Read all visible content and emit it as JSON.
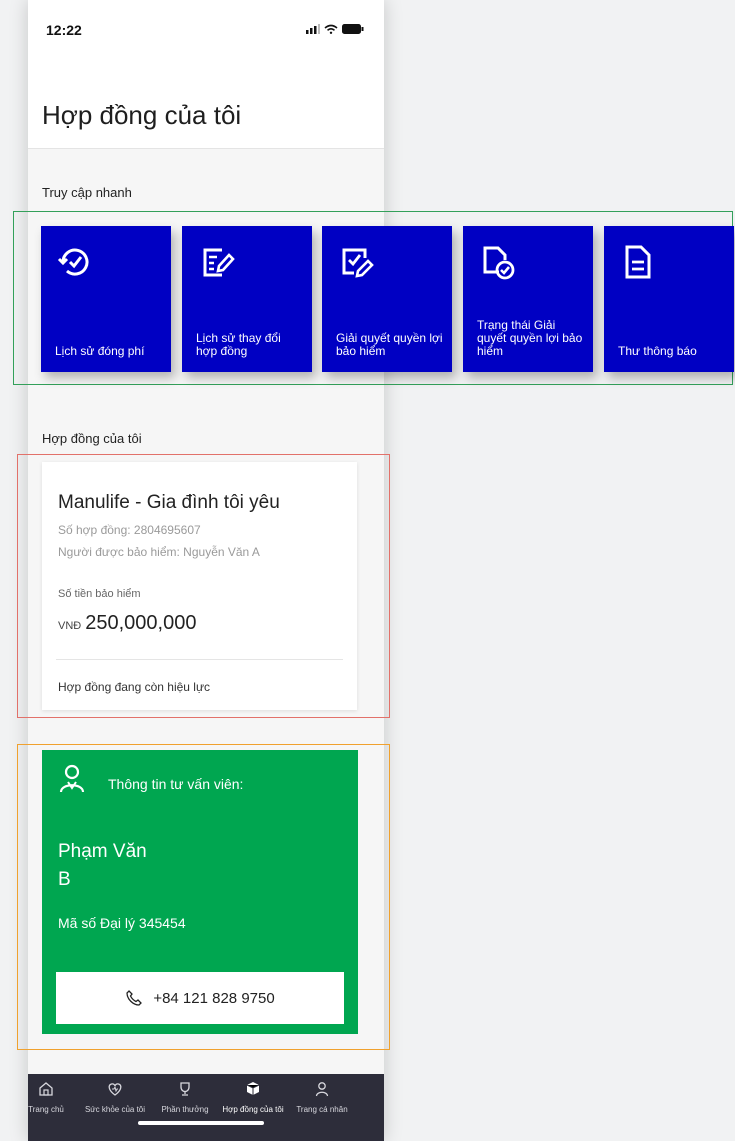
{
  "status_bar": {
    "time": "12:22"
  },
  "page_title": "Hợp đồng của tôi",
  "quick_access": {
    "heading": "Truy cập nhanh",
    "tiles": [
      {
        "label": "Lịch sử đóng phí",
        "icon": "history-check-icon"
      },
      {
        "label": "Lịch sử thay đổi hợp đồng",
        "icon": "document-edit-icon"
      },
      {
        "label": "Giải quyết quyền lợi bảo hiểm",
        "icon": "checkbox-edit-icon"
      },
      {
        "label": "Trạng thái Giải quyết quyền lợi bảo hiểm",
        "icon": "document-check-icon"
      },
      {
        "label": "Thư thông báo",
        "icon": "document-icon"
      }
    ],
    "tile_color": "#0000c3"
  },
  "contracts": {
    "heading": "Hợp đồng của tôi",
    "card": {
      "product_name": "Manulife - Gia đình tôi yêu",
      "contract_number": "Số hợp đồng: 2804695607",
      "insured": "Người được bảo hiểm: Nguyễn Văn A",
      "sum_assured_label": "Số tiền bảo hiểm",
      "currency": "VNĐ",
      "sum_assured": "250,000,000",
      "status": "Hợp đồng đang còn hiệu lực"
    }
  },
  "agent": {
    "heading": "Thông tin tư vấn viên:",
    "name": "Phạm Văn B",
    "agent_code": "Mã số Đại lý 345454",
    "phone": "+84 121 828 9750",
    "color": "#00a650",
    "icon": "agent-person-icon"
  },
  "bottom_nav": {
    "items": [
      {
        "label": "Trang chủ",
        "icon": "home-icon"
      },
      {
        "label": "Sức khỏe của tôi",
        "icon": "heart-icon"
      },
      {
        "label": "Phần thưởng",
        "icon": "trophy-icon"
      },
      {
        "label": "Hợp đồng của tôi",
        "icon": "box-icon",
        "active": true
      },
      {
        "label": "Trang cá nhân",
        "icon": "person-icon"
      }
    ]
  }
}
